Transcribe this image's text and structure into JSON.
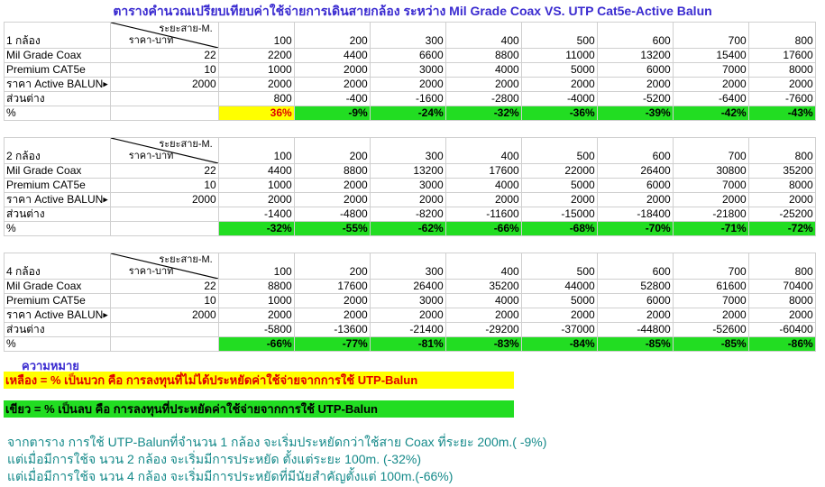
{
  "title": "ตารางคำนวณเปรียบเทียบค่าใช้จ่ายการเดินสายกล้อง ระหว่าง Mil Grade Coax VS. UTP Cat5e-Active Balun",
  "colors": {
    "title": "#3a2bd0",
    "yellow": "#ffff00",
    "green": "#22dd22",
    "red_text": "#e00000",
    "note": "#158a8a"
  },
  "distance_header": "ระยะสาย-M.",
  "price_header": "ราคา-บาท",
  "distances": [
    "100",
    "200",
    "300",
    "400",
    "500",
    "600",
    "700",
    "800"
  ],
  "tables": [
    {
      "label": "1 กล้อง",
      "rows": [
        {
          "name": "Mil Grade Coax",
          "price": "22",
          "values": [
            "2200",
            "4400",
            "6600",
            "8800",
            "11000",
            "13200",
            "15400",
            "17600"
          ]
        },
        {
          "name": "Premium CAT5e",
          "price": "10",
          "values": [
            "1000",
            "2000",
            "3000",
            "4000",
            "5000",
            "6000",
            "7000",
            "8000"
          ]
        },
        {
          "name": "ราคา Active BALUN",
          "price": "2000",
          "values": [
            "2000",
            "2000",
            "2000",
            "2000",
            "2000",
            "2000",
            "2000",
            "2000"
          ]
        },
        {
          "name": "ส่วนต่าง",
          "price": "",
          "values": [
            "800",
            "-400",
            "-1600",
            "-2800",
            "-4000",
            "-5200",
            "-6400",
            "-7600"
          ]
        }
      ],
      "percent_label": "%",
      "percent": [
        "36%",
        "-9%",
        "-24%",
        "-32%",
        "-36%",
        "-39%",
        "-42%",
        "-43%"
      ]
    },
    {
      "label": "2 กล้อง",
      "rows": [
        {
          "name": "Mil Grade Coax",
          "price": "22",
          "values": [
            "4400",
            "8800",
            "13200",
            "17600",
            "22000",
            "26400",
            "30800",
            "35200"
          ]
        },
        {
          "name": "Premium CAT5e",
          "price": "10",
          "values": [
            "1000",
            "2000",
            "3000",
            "4000",
            "5000",
            "6000",
            "7000",
            "8000"
          ]
        },
        {
          "name": "ราคา Active BALUN",
          "price": "2000",
          "values": [
            "2000",
            "2000",
            "2000",
            "2000",
            "2000",
            "2000",
            "2000",
            "2000"
          ]
        },
        {
          "name": "ส่วนต่าง",
          "price": "",
          "values": [
            "-1400",
            "-4800",
            "-8200",
            "-11600",
            "-15000",
            "-18400",
            "-21800",
            "-25200"
          ]
        }
      ],
      "percent_label": "%",
      "percent": [
        "-32%",
        "-55%",
        "-62%",
        "-66%",
        "-68%",
        "-70%",
        "-71%",
        "-72%"
      ]
    },
    {
      "label": "4 กล้อง",
      "rows": [
        {
          "name": "Mil Grade Coax",
          "price": "22",
          "values": [
            "8800",
            "17600",
            "26400",
            "35200",
            "44000",
            "52800",
            "61600",
            "70400"
          ]
        },
        {
          "name": "Premium CAT5e",
          "price": "10",
          "values": [
            "1000",
            "2000",
            "3000",
            "4000",
            "5000",
            "6000",
            "7000",
            "8000"
          ]
        },
        {
          "name": "ราคา Active BALUN",
          "price": "2000",
          "values": [
            "2000",
            "2000",
            "2000",
            "2000",
            "2000",
            "2000",
            "2000",
            "2000"
          ]
        },
        {
          "name": "ส่วนต่าง",
          "price": "",
          "values": [
            "-5800",
            "-13600",
            "-21400",
            "-29200",
            "-37000",
            "-44800",
            "-52600",
            "-60400"
          ]
        }
      ],
      "percent_label": "%",
      "percent": [
        "-66%",
        "-77%",
        "-81%",
        "-83%",
        "-84%",
        "-85%",
        "-85%",
        "-86%"
      ]
    }
  ],
  "legend": {
    "title": "ความหมาย",
    "yellow": "เหลือง = % เป็นบวก คือ การลงทุนที่ไม่ได้ประหยัดค่าใช้จ่ายจากการใช้ UTP-Balun",
    "green": "เขียว = % เป็นลบ คือ การลงทุนที่ประหยัดค่าใช้จ่ายจากการใช้ UTP-Balun"
  },
  "notes": [
    "จากตาราง การใช้ UTP-Balunที่จำนวน 1 กล้อง จะเริ่มประหยัดกว่าใช้สาย Coax ที่ระยะ 200m.( -9%)",
    "แต่เมื่อมีการใช้จ  นวน 2 กล้อง จะเริ่มมีการประหยัด ตั้งแต่ระยะ 100m. (-32%)",
    "แต่เมื่อมีการใช้จ  นวน 4 กล้อง จะเริ่มมีการประหยัดที่มีนัยสำคัญตั้งแต่ 100m.(-66%)"
  ]
}
